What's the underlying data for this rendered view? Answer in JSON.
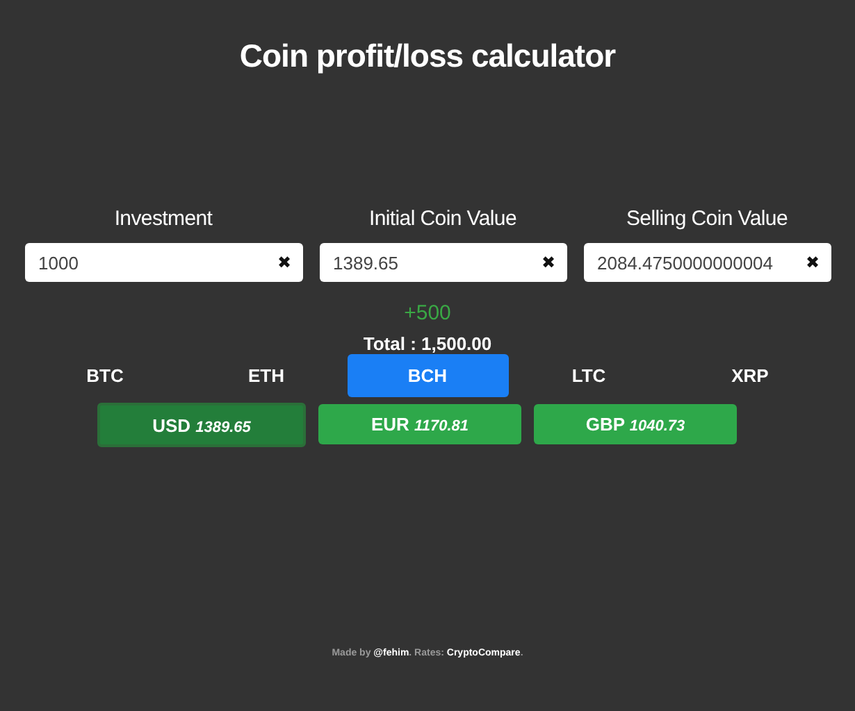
{
  "title": "Coin profit/loss calculator",
  "fields": [
    {
      "label": "Investment",
      "value": "1000",
      "clear": "✖"
    },
    {
      "label": "Initial Coin Value",
      "value": "1389.65",
      "clear": "✖"
    },
    {
      "label": "Selling Coin Value",
      "value": "2084.4750000000004",
      "clear": "✖"
    }
  ],
  "profit": {
    "text": "+500",
    "kind": "gain"
  },
  "total": "Total : 1,500.00",
  "coins": [
    {
      "label": "BTC",
      "selected": false
    },
    {
      "label": "ETH",
      "selected": false
    },
    {
      "label": "BCH",
      "selected": true
    },
    {
      "label": "LTC",
      "selected": false
    },
    {
      "label": "XRP",
      "selected": false
    }
  ],
  "currencies": [
    {
      "code": "USD",
      "rate": "1389.65",
      "selected": true
    },
    {
      "code": "EUR",
      "rate": "1170.81",
      "selected": false
    },
    {
      "code": "GBP",
      "rate": "1040.73",
      "selected": false
    }
  ],
  "footer": {
    "prefix": "Made by ",
    "author": "@fehim",
    "middle": ". Rates: ",
    "source": "CryptoCompare",
    "suffix": "."
  }
}
